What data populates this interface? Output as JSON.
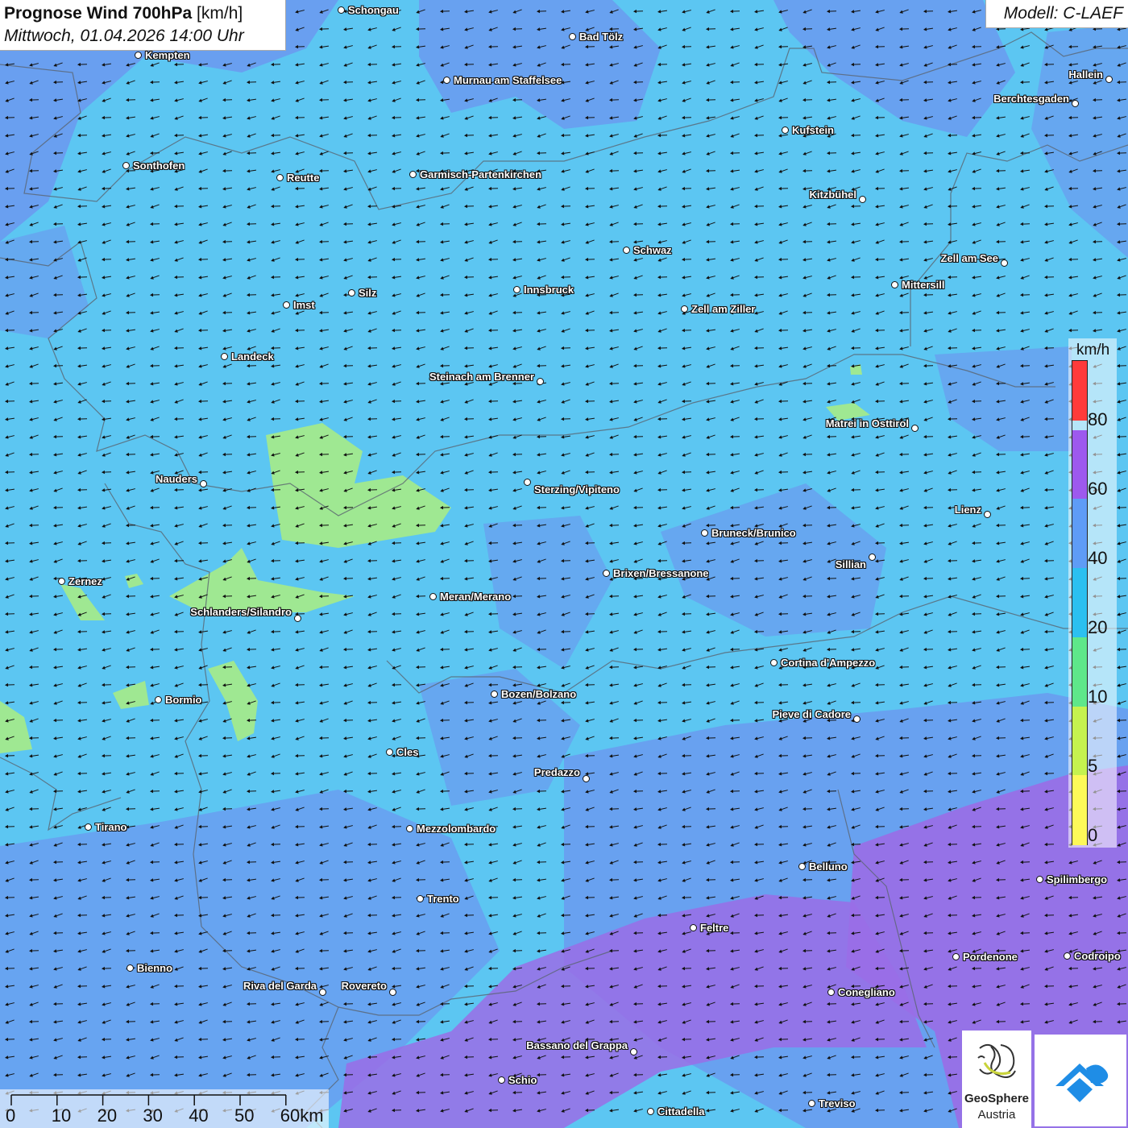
{
  "header": {
    "title": "Prognose Wind 700hPa",
    "unit": "[km/h]",
    "datetime": "Mittwoch, 01.04.2026 14:00 Uhr"
  },
  "model": {
    "label": "Modell: C-LAEF"
  },
  "legend": {
    "unit": "km/h",
    "ticks": [
      "80",
      "60",
      "40",
      "20",
      "10",
      "5",
      "0"
    ],
    "colors": [
      "#ff3b3b",
      "#9d59ee",
      "#5e9cf6",
      "#2bc0f0",
      "#5ee78a",
      "#c5f24f",
      "#fdf959"
    ]
  },
  "scale": {
    "labels": [
      "0",
      "10",
      "20",
      "30",
      "40",
      "50",
      "60km"
    ]
  },
  "wind": {
    "direction": "arrows pointing west/south-west",
    "colors": {
      "base": "#5cc6f2",
      "low": "#a6eb87",
      "high": "#9a6de6",
      "mid": "#6d92ef"
    }
  },
  "cities": [
    {
      "name": "Schongau"
    },
    {
      "name": "Bad Tölz"
    },
    {
      "name": "Kempten"
    },
    {
      "name": "Murnau am Staffelsee"
    },
    {
      "name": "Hallein"
    },
    {
      "name": "Berchtesgaden"
    },
    {
      "name": "Kufstein"
    },
    {
      "name": "Sonthofen"
    },
    {
      "name": "Reutte"
    },
    {
      "name": "Garmisch-Partenkirchen"
    },
    {
      "name": "Kitzbühel"
    },
    {
      "name": "Schwaz"
    },
    {
      "name": "Zell am See"
    },
    {
      "name": "Mittersill"
    },
    {
      "name": "Imst"
    },
    {
      "name": "Silz"
    },
    {
      "name": "Innsbruck"
    },
    {
      "name": "Zell am Ziller"
    },
    {
      "name": "Landeck"
    },
    {
      "name": "Steinach am Brenner"
    },
    {
      "name": "Matrei in Osttirol"
    },
    {
      "name": "Nauders"
    },
    {
      "name": "Sterzing/Vipiteno"
    },
    {
      "name": "Lienz"
    },
    {
      "name": "Bruneck/Brunico"
    },
    {
      "name": "Sillian"
    },
    {
      "name": "Zernez"
    },
    {
      "name": "Brixen/Bressanone"
    },
    {
      "name": "Meran/Merano"
    },
    {
      "name": "Schlanders/Silandro"
    },
    {
      "name": "Cortina d'Ampezzo"
    },
    {
      "name": "Bozen/Bolzano"
    },
    {
      "name": "Bormio"
    },
    {
      "name": "Pieve di Cadore"
    },
    {
      "name": "Cles"
    },
    {
      "name": "Predazzo"
    },
    {
      "name": "Tirano"
    },
    {
      "name": "Mezzolombardo"
    },
    {
      "name": "Belluno"
    },
    {
      "name": "Spilimbergo"
    },
    {
      "name": "Trento"
    },
    {
      "name": "Feltre"
    },
    {
      "name": "Pordenone"
    },
    {
      "name": "Codroipo"
    },
    {
      "name": "Bienno"
    },
    {
      "name": "Riva del Garda"
    },
    {
      "name": "Rovereto"
    },
    {
      "name": "Conegliano"
    },
    {
      "name": "Bassano del Grappa"
    },
    {
      "name": "Schio"
    },
    {
      "name": "Treviso"
    },
    {
      "name": "Cittadella"
    }
  ],
  "logos": {
    "geosphere": {
      "name": "GeoSphere",
      "sub": "Austria"
    }
  }
}
